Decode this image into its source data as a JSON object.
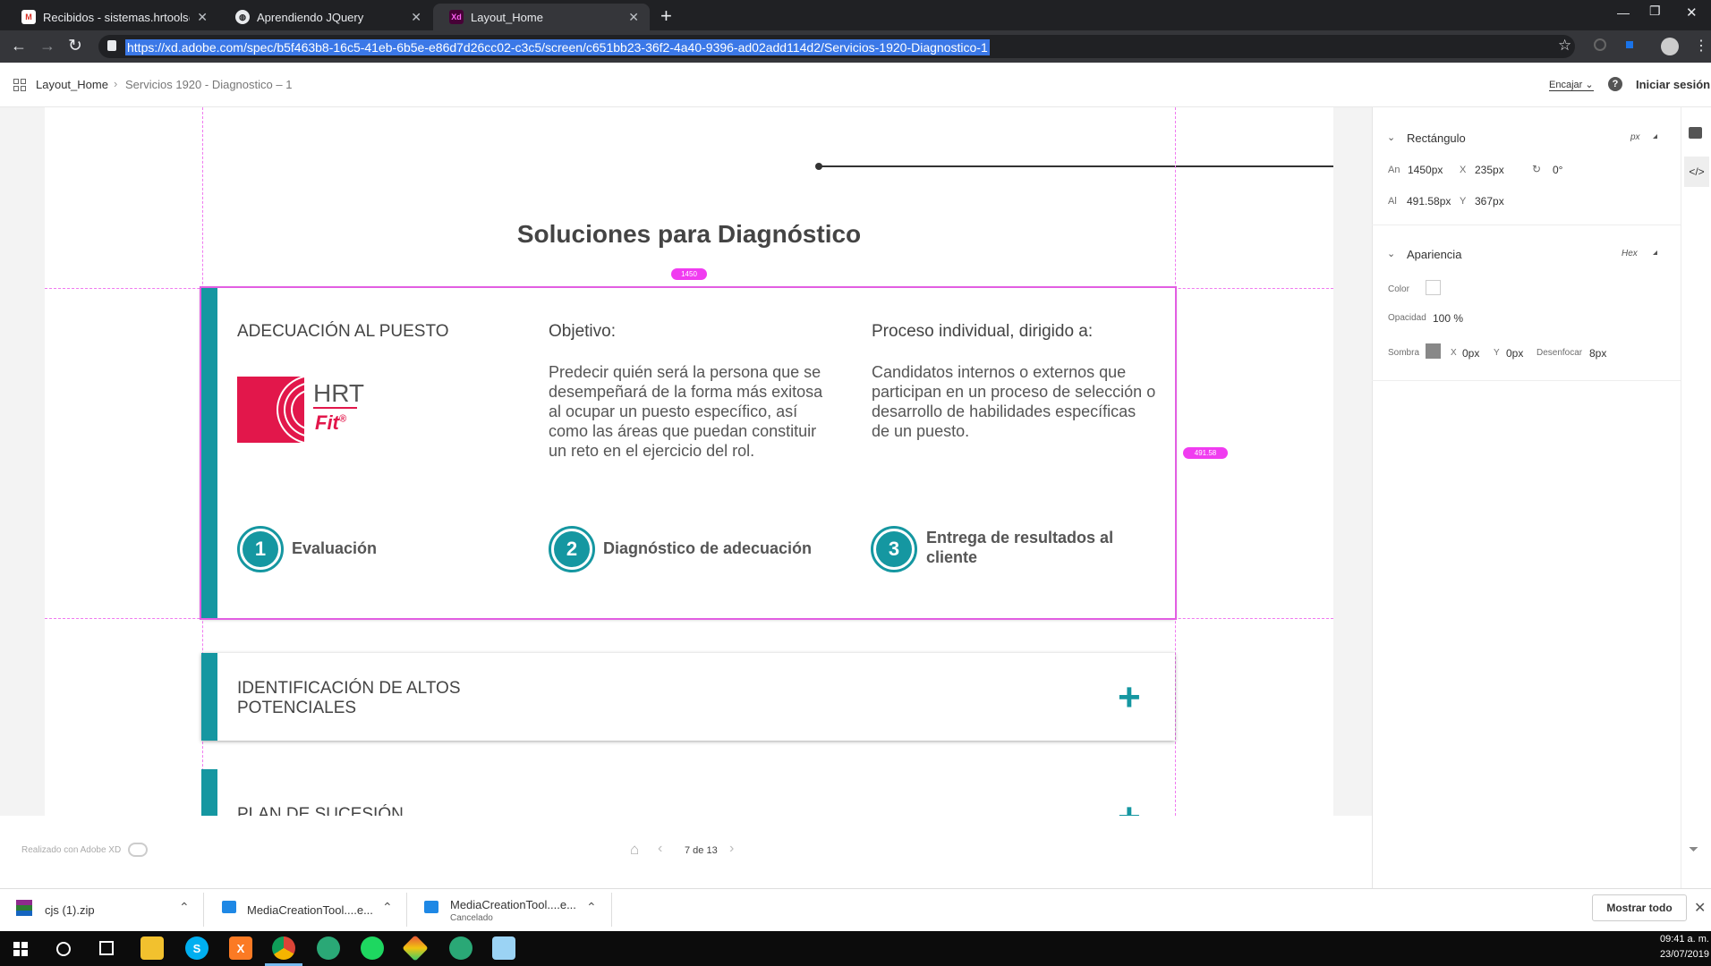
{
  "browser": {
    "tabs": [
      {
        "title": "Recibidos - sistemas.hrtools@gm",
        "icon": "gmail-icon"
      },
      {
        "title": "Aprendiendo JQuery",
        "icon": "globe-icon"
      },
      {
        "title": "Layout_Home",
        "icon": "xd-icon",
        "favicon_text": "Xd"
      }
    ],
    "url": "https://xd.adobe.com/spec/b5f463b8-16c5-41eb-6b5e-e86d7d26cc02-c3c5/screen/c651bb23-36f2-4a40-9396-ad02add114d2/Servicios-1920-Diagnostico-1"
  },
  "xd": {
    "breadcrumb": {
      "root": "Layout_Home",
      "current": "Servicios 1920 - Diagnostico – 1"
    },
    "fit_label": "Encajar",
    "help": "?",
    "signin": "Iniciar sesión",
    "made_with": "Realizado con Adobe XD",
    "pager": "7 de 13"
  },
  "design": {
    "heading": "Soluciones para Diagnóstico",
    "width_badge": "1450",
    "height_badge": "491.58",
    "card1": {
      "title": "ADECUACIÓN AL PUESTO",
      "logo_hrt": "HRT",
      "logo_fit": "Fit",
      "logo_reg": "®",
      "obj_title": "Objetivo:",
      "obj_text": "Predecir quién será la persona que se desempeñará de la forma más exitosa al ocupar un puesto específico, así como las áreas que puedan constituir un reto en el ejercicio del rol.",
      "proc_title": "Proceso individual, dirigido a:",
      "proc_text": "Candidatos internos o externos que participan en un proceso de selección o desarrollo de habilidades específicas de un puesto.",
      "steps": [
        {
          "num": "1",
          "label": "Evaluación"
        },
        {
          "num": "2",
          "label": "Diagnóstico de adecuación"
        },
        {
          "num": "3",
          "label": "Entrega de resultados al cliente"
        }
      ]
    },
    "card2": {
      "title": "IDENTIFICACIÓN DE ALTOS POTENCIALES"
    },
    "card3": {
      "title": "PLAN DE SUCESIÓN"
    },
    "plus": "+"
  },
  "panel": {
    "rect_title": "Rectángulo",
    "unit": "px",
    "an_label": "An",
    "an_value": "1450px",
    "x_label": "X",
    "x_value": "235px",
    "rot_value": "0°",
    "al_label": "Al",
    "al_value": "491.58px",
    "y_label": "Y",
    "y_value": "367px",
    "appearance_title": "Apariencia",
    "color_mode": "Hex",
    "color_label": "Color",
    "opacity_label": "Opacidad",
    "opacity_value": "100 %",
    "shadow_label": "Sombra",
    "sx_label": "X",
    "sx_value": "0px",
    "sy_label": "Y",
    "sy_value": "0px",
    "blur_label": "Desenfocar",
    "blur_value": "8px"
  },
  "downloads": [
    {
      "name": "cjs (1).zip",
      "status": ""
    },
    {
      "name": "MediaCreationTool....e...",
      "status": ""
    },
    {
      "name": "MediaCreationTool....e...",
      "status": "Cancelado"
    }
  ],
  "show_all": "Mostrar todo",
  "clock": {
    "time": "09:41 a. m.",
    "date": "23/07/2019"
  },
  "colors": {
    "accent": "#1597a1",
    "brand_red": "#e2174b",
    "guide": "#f07af0"
  }
}
